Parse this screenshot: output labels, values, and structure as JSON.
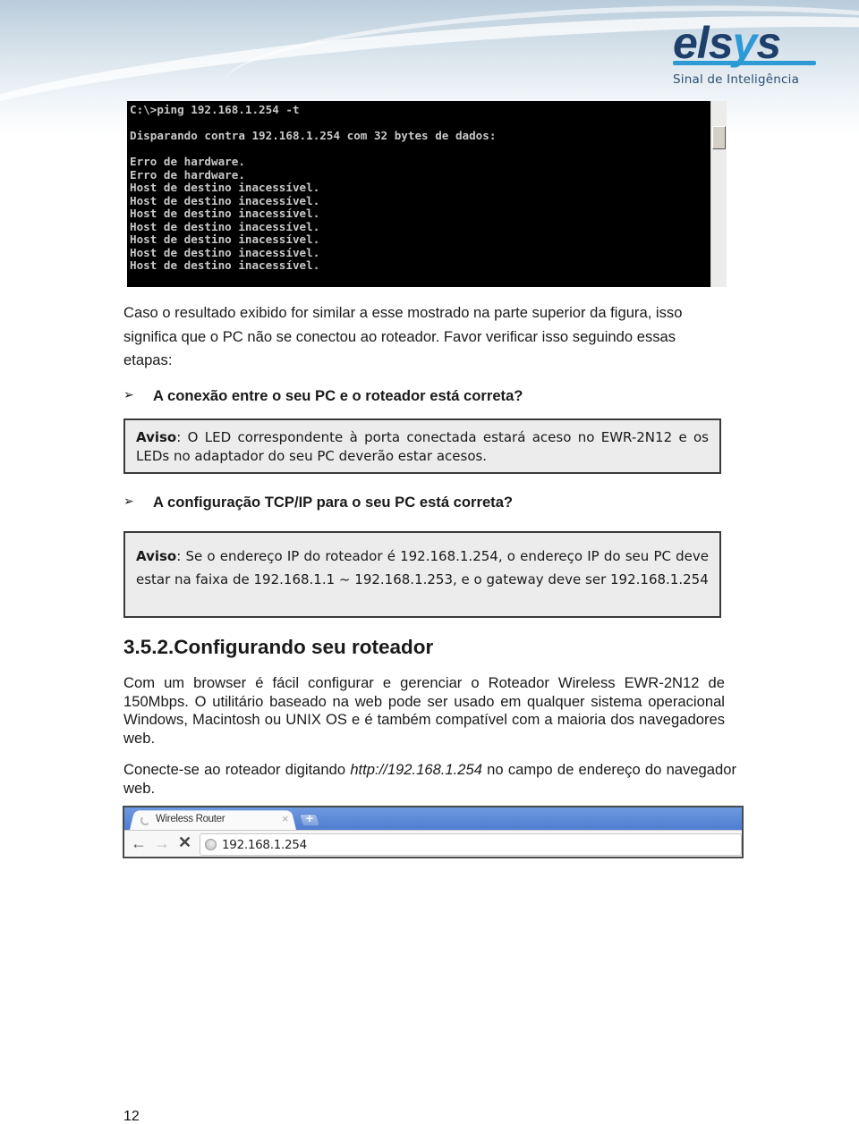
{
  "header": {
    "logo_text_main": "els",
    "logo_text_accent": "y",
    "logo_text_end": "s",
    "logo_tagline": "Sinal de Inteligência"
  },
  "console": {
    "lines": [
      "C:\\>ping 192.168.1.254 -t",
      "",
      "Disparando contra 192.168.1.254 com 32 bytes de dados:",
      "",
      "Erro de hardware.",
      "Erro de hardware.",
      "Host de destino inacessível.",
      "Host de destino inacessível.",
      "Host de destino inacessível.",
      "Host de destino inacessível.",
      "Host de destino inacessível.",
      "Host de destino inacessível.",
      "Host de destino inacessível."
    ]
  },
  "content": {
    "para1": "Caso o resultado exibido for similar a esse mostrado na parte superior da figura, isso significa que o PC não se conectou ao roteador. Favor verificar isso seguindo essas etapas:",
    "bullet_glyph": "➢",
    "bullet1": "A conexão entre o seu PC e o roteador está correta?",
    "notice1_label": "Aviso",
    "notice1_text": ": O LED correspondente à porta conectada estará aceso no EWR-2N12 e os LEDs no adaptador do seu PC deverão estar acesos.",
    "bullet2": "A configuração TCP/IP para o seu PC está correta?",
    "notice2_label": "Aviso",
    "notice2_text": ": Se o endereço IP do roteador é 192.168.1.254, o endereço IP do seu PC deve estar na faixa de 192.168.1.1 ~ 192.168.1.253, e o gateway deve ser 192.168.1.254",
    "section_title": "3.5.2.Configurando seu roteador",
    "para2": "Com um browser é fácil configurar e gerenciar o Roteador Wireless EWR-2N12 de 150Mbps. O utilitário baseado na web pode ser usado em qualquer sistema operacional Windows, Macintosh ou UNIX OS e é também compatível com a maioria dos navegadores web.",
    "para3_before": "Conecte-se ao roteador digitando ",
    "para3_url": "http://192.168.1.254",
    "para3_after": " no campo de endereço do navegador web."
  },
  "browser": {
    "tab_title": "Wireless Router",
    "tab_close": "×",
    "new_tab": "+",
    "back": "←",
    "forward": "→",
    "stop": "✕",
    "address": "192.168.1.254"
  },
  "footer": {
    "page_number": "12"
  }
}
